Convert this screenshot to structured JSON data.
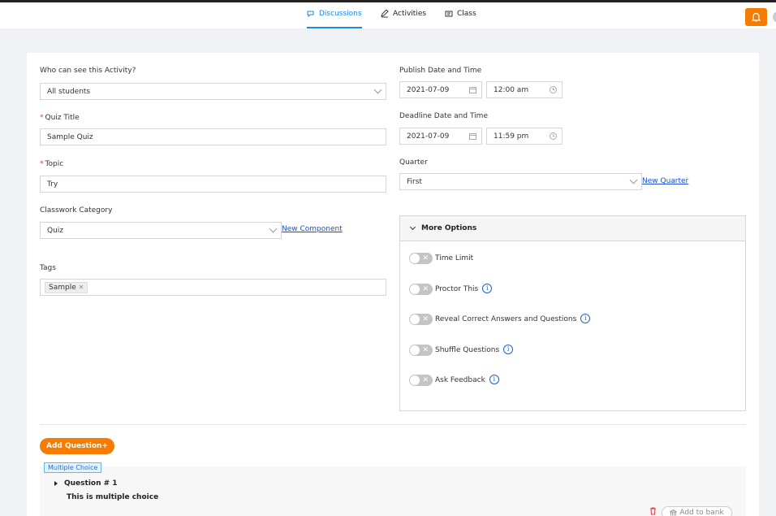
{
  "nav": {
    "tabs": [
      {
        "label": "Discussions",
        "icon": "chat-icon",
        "active": true
      },
      {
        "label": "Activities",
        "icon": "pencil-icon",
        "active": false
      },
      {
        "label": "Class",
        "icon": "class-icon",
        "active": false
      }
    ]
  },
  "colors": {
    "accent": "#1e88e5",
    "brand_orange": "#f57c00",
    "link": "#1a4fcf",
    "required": "#e53935"
  },
  "form": {
    "visibility": {
      "label": "Who can see this Activity?",
      "value": "All students"
    },
    "quiz_title": {
      "label": "Quiz Title",
      "value": "Sample Quiz"
    },
    "topic": {
      "label": "Topic",
      "value": "Try"
    },
    "category": {
      "label": "Classwork Category",
      "value": "Quiz",
      "link": "New Component"
    },
    "tags": {
      "label": "Tags",
      "items": [
        "Sample"
      ]
    },
    "publish": {
      "label": "Publish Date and Time",
      "date": "2021-07-09",
      "time": "12:00 am"
    },
    "deadline": {
      "label": "Deadline Date and Time",
      "date": "2021-07-09",
      "time": "11:59 pm"
    },
    "quarter": {
      "label": "Quarter",
      "value": "First",
      "link": "New Quarter"
    }
  },
  "more_options": {
    "title": "More Options",
    "items": [
      {
        "label": "Time Limit",
        "info": false,
        "on": false
      },
      {
        "label": "Proctor This",
        "info": true,
        "on": false
      },
      {
        "label": "Reveal Correct Answers and Questions",
        "info": true,
        "on": false
      },
      {
        "label": "Shuffle Questions",
        "info": true,
        "on": false
      },
      {
        "label": "Ask Feedback",
        "info": true,
        "on": false
      }
    ]
  },
  "questions": {
    "add_label": "Add Question+",
    "type_badge": "Multiple Choice",
    "title": "Question # 1",
    "text": "This is multiple choice",
    "add_to_bank": "Add to bank"
  }
}
